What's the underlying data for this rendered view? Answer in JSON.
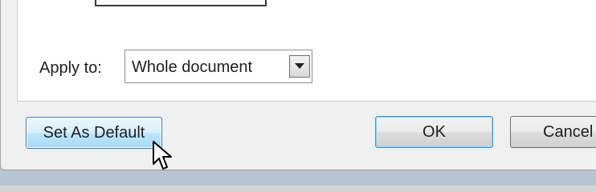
{
  "apply_to": {
    "label": "Apply to:",
    "value": "Whole document"
  },
  "buttons": {
    "set_default": "Set As Default",
    "ok": "OK",
    "cancel": "Cancel"
  },
  "icons": {
    "dropdown": "chevron-down-icon",
    "cursor": "mouse-pointer-icon"
  },
  "colors": {
    "default_button_fill": "#bee6fd",
    "default_button_border": "#3c7fb1",
    "ok_focus_border": "#3399dd"
  }
}
